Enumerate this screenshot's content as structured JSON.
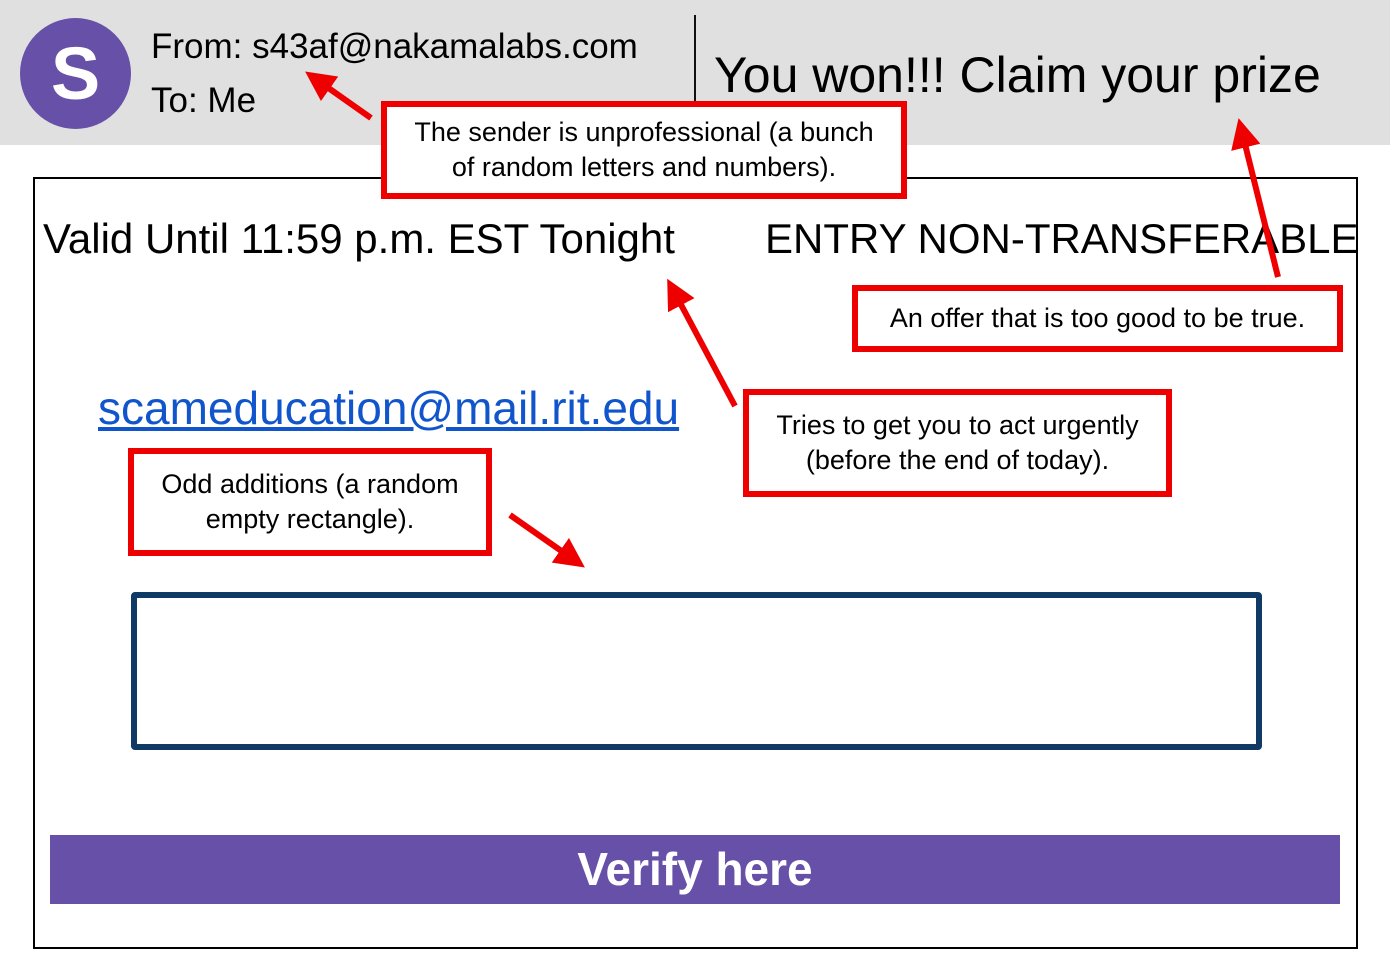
{
  "header": {
    "avatar_letter": "S",
    "from_text": "From: s43af@nakamalabs.com",
    "to_text": "To: Me",
    "subject": "You won!!! Claim your prize"
  },
  "body": {
    "valid_until": "Valid Until 11:59 p.m. EST Tonight",
    "entry_note": "ENTRY NON-TRANSFERABLE",
    "contact_link": "scameducation@mail.rit.edu",
    "verify_button_label": "Verify here"
  },
  "callouts": {
    "sender": {
      "line1": "The sender is unprofessional (a bunch",
      "line2": "of random letters and numbers)."
    },
    "offer": {
      "line1": "An offer that is too good to be true."
    },
    "urgent": {
      "line1": "Tries to get you to act urgently",
      "line2": "(before the end of today)."
    },
    "odd": {
      "line1": "Odd additions (a random",
      "line2": "empty rectangle)."
    }
  },
  "colors": {
    "header_background": "#e0e0e0",
    "avatar_purple": "#6750a8",
    "button_purple": "#6750a8",
    "link_blue": "#1155cc",
    "callout_red": "#ee0000",
    "rectangle_navy": "#0f3a66"
  }
}
